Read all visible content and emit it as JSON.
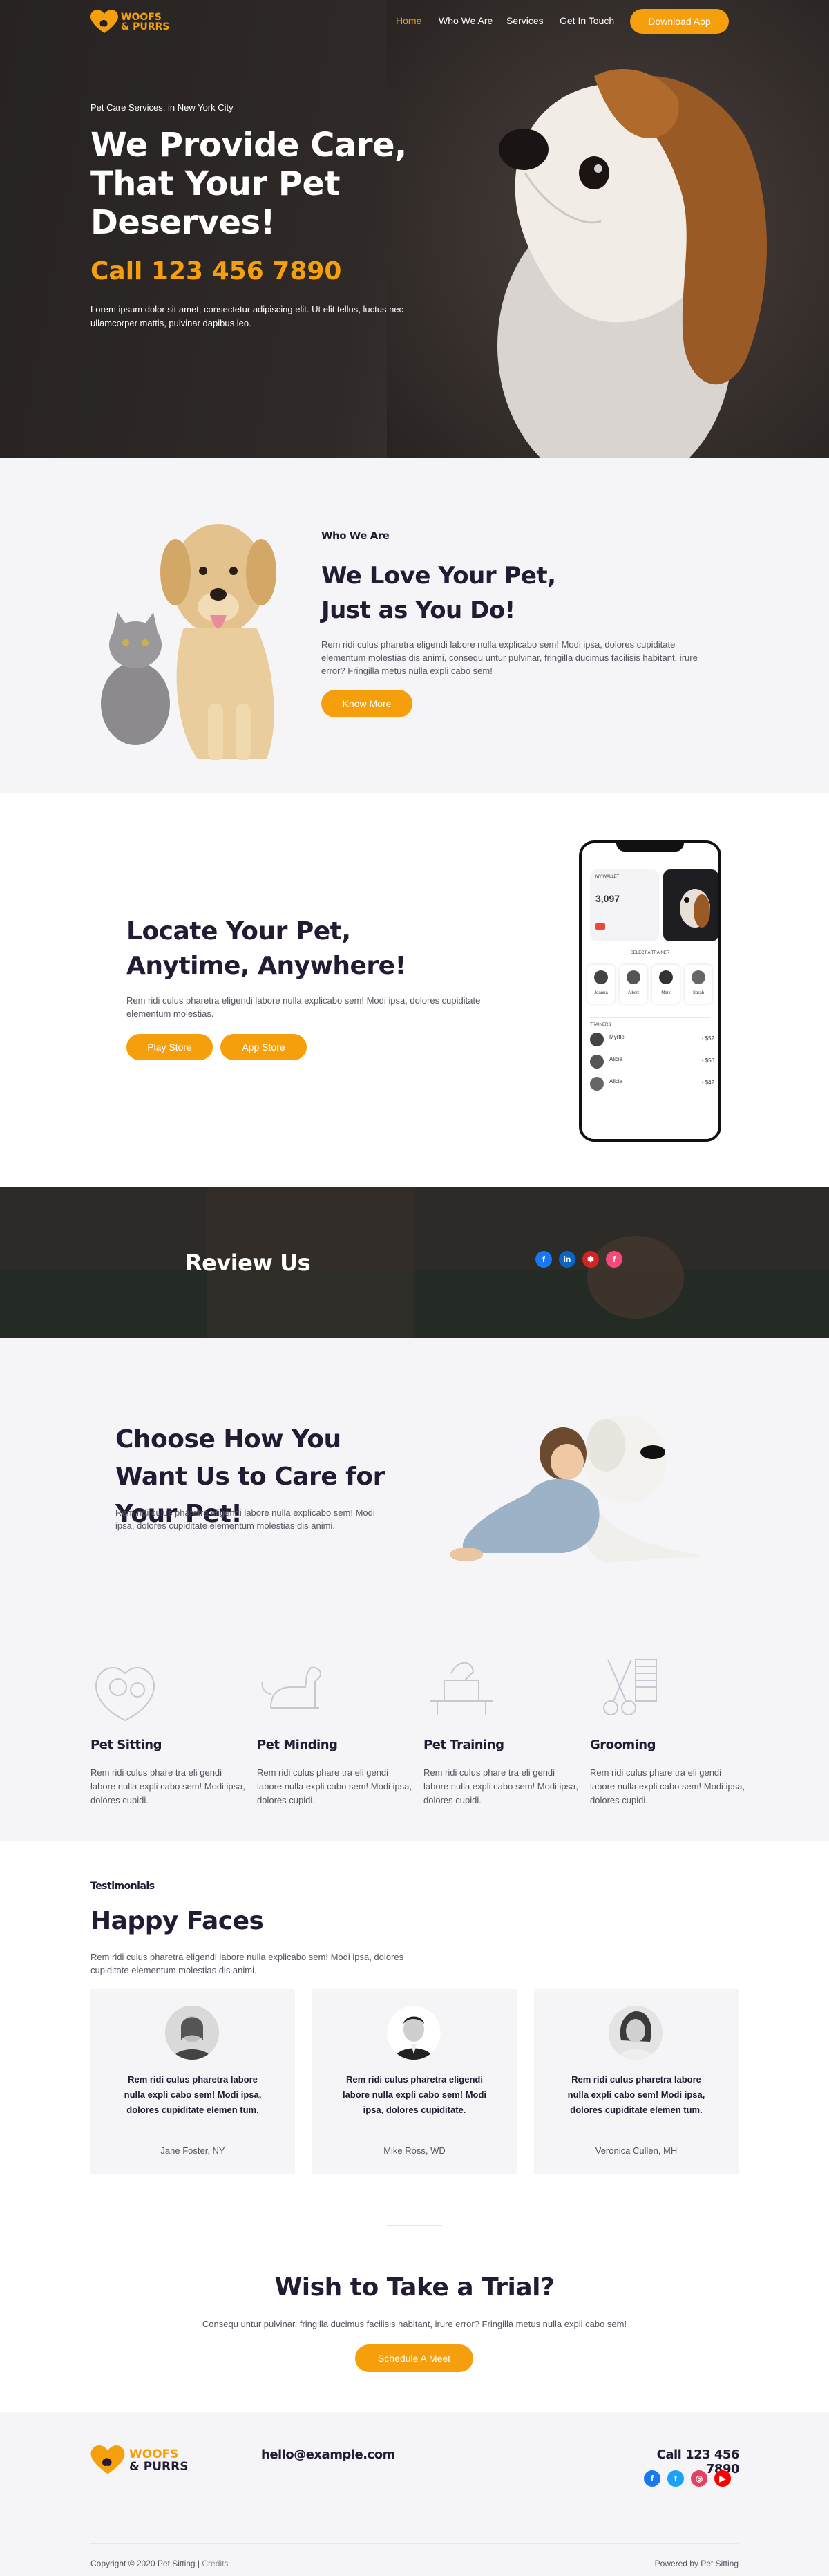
{
  "brand": {
    "line1": "WOOFS",
    "line2": "& PURRS",
    "accent": "#f69f0d"
  },
  "nav": {
    "items": [
      "Home",
      "Who We Are",
      "Services",
      "Get In Touch"
    ],
    "active": "Home",
    "cta": "Download App"
  },
  "hero": {
    "subtitle": "Pet Care Services, in New York City",
    "title": "We Provide Care, That Your Pet Deserves!",
    "phone": "Call 123 456 7890",
    "text": "Lorem ipsum dolor sit amet, consectetur adipiscing elit. Ut elit tellus, luctus nec ullamcorper mattis, pulvinar dapibus leo."
  },
  "who": {
    "kicker": "Who We Are",
    "title": "We Love Your Pet, Just as You Do!",
    "text": "Rem ridi culus pharetra eligendi labore nulla explicabo sem! Modi ipsa, dolores cupiditate elementum molestias dis animi, consequ untur pulvinar, fringilla ducimus facilisis habitant, irure error? Fringilla metus nulla expli cabo sem!",
    "button": "Know More"
  },
  "locate": {
    "title": "Locate Your Pet, Anytime, Anywhere!",
    "text": "Rem ridi culus pharetra eligendi labore nulla explicabo sem! Modi ipsa, dolores cupiditate elementum molestias.",
    "buttons": [
      "Play Store",
      "App Store"
    ],
    "phone": {
      "card_label": "MY WALLET",
      "card_value": "3,097",
      "section": "SELECT A TRAINER",
      "trainers": [
        "Joanna",
        "Albert",
        "Mark",
        "Sarah"
      ],
      "list_header": "TRAINERS",
      "rows": [
        {
          "name": "Myrtle",
          "value": "- $52"
        },
        {
          "name": "Alicia",
          "value": "- $50"
        },
        {
          "name": "Alicia",
          "value": "- $42"
        }
      ]
    }
  },
  "review": {
    "title": "Review Us",
    "icons": [
      "facebook-icon",
      "linkedin-icon",
      "yelp-icon",
      "foursquare-icon"
    ]
  },
  "choose": {
    "title": "Choose How You Want Us to Care for Your Pet!",
    "text": "Rem ridi culus pharetra eligendi labore nulla explicabo sem! Modi ipsa, dolores cupiditate elementum molestias dis animi.",
    "services": [
      {
        "title": "Pet Sitting",
        "text": "Rem ridi culus phare tra eli gendi labore nulla expli cabo sem! Modi ipsa, dolores cupidi."
      },
      {
        "title": "Pet Minding",
        "text": "Rem ridi culus phare tra eli gendi labore nulla expli cabo sem! Modi ipsa, dolores cupidi."
      },
      {
        "title": "Pet Training",
        "text": "Rem ridi culus phare tra eli gendi labore nulla expli cabo sem! Modi ipsa, dolores cupidi."
      },
      {
        "title": "Grooming",
        "text": "Rem ridi culus phare tra eli gendi labore nulla expli cabo sem! Modi ipsa, dolores cupidi."
      }
    ]
  },
  "testimonials": {
    "kicker": "Testimonials",
    "title": "Happy Faces",
    "text": "Rem ridi culus pharetra eligendi labore nulla explicabo sem! Modi ipsa, dolores cupiditate elementum molestias dis animi.",
    "items": [
      {
        "quote": "Rem ridi culus pharetra labore nulla expli cabo sem! Modi ipsa, dolores cupiditate elemen tum.",
        "name": "Jane Foster, NY"
      },
      {
        "quote": "Rem ridi culus pharetra eligendi labore nulla expli cabo sem! Modi ipsa, dolores cupiditate.",
        "name": "Mike Ross, WD"
      },
      {
        "quote": "Rem ridi culus pharetra labore nulla expli cabo sem! Modi ipsa, dolores cupiditate elemen tum.",
        "name": "Veronica Cullen, MH"
      }
    ]
  },
  "trial": {
    "title": "Wish to Take a Trial?",
    "text": "Consequ untur pulvinar, fringilla ducimus facilisis habitant, irure error? Fringilla metus nulla expli cabo sem!",
    "button": "Schedule A Meet"
  },
  "footer": {
    "email": "hello@example.com",
    "phone": "Call 123 456 7890",
    "icons": [
      "facebook-icon",
      "twitter-icon",
      "instagram-icon",
      "youtube-icon"
    ],
    "copyright": "Copyright © 2020 Pet Sitting |",
    "credits": "Credits",
    "powered": "Powered by Pet Sitting"
  }
}
